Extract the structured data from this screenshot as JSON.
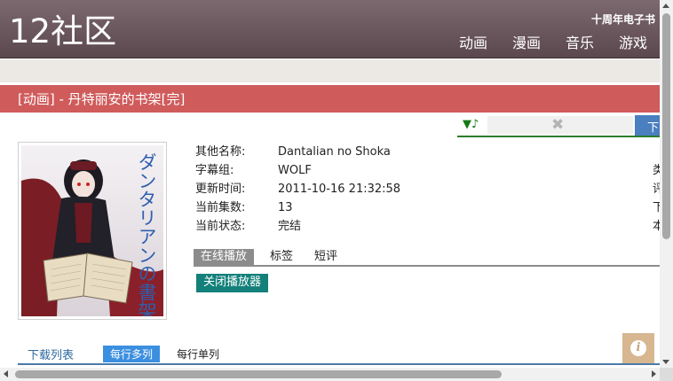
{
  "header": {
    "logo": "12社区",
    "anniversary": "十周年电子书",
    "nav": [
      "动画",
      "漫画",
      "音乐",
      "游戏"
    ]
  },
  "title": "[动画] - 丹特丽安的书架[完]",
  "player_bar": {
    "note_icon": "▼♪",
    "plugin_icon": "puzzle-icon",
    "download_partial": "下"
  },
  "cover": {
    "title_text": "ダンタリアンの書架"
  },
  "details": [
    {
      "key": "其他名称:",
      "value": "Dantalian no Shoka",
      "right": "类"
    },
    {
      "key": "字幕组:",
      "value": "WOLF",
      "right": "评"
    },
    {
      "key": "更新时间:",
      "value": "2011-10-16 21:32:58",
      "right": "下"
    },
    {
      "key": "当前集数:",
      "value": "13",
      "right": "下"
    },
    {
      "key": "当前状态:",
      "value": "完结",
      "right": "本"
    }
  ],
  "tabs": [
    "在线播放",
    "标签",
    "短评"
  ],
  "close_player": "关闭播放器",
  "download_list": {
    "label": "下载列表",
    "option_multi": "每行多列",
    "option_single": "每行单列"
  },
  "colors": {
    "header": "#6d5960",
    "title_bar": "#d05b5b",
    "close_button": "#13807a",
    "active_option": "#3b8fe0"
  }
}
